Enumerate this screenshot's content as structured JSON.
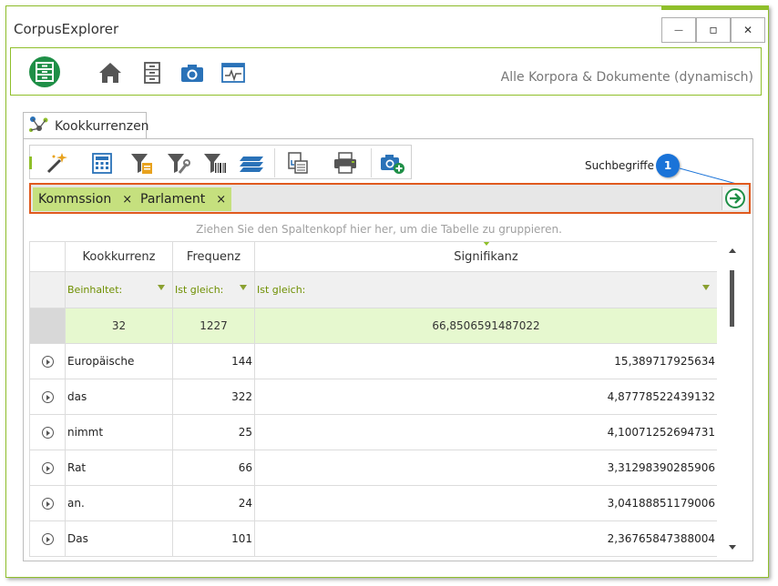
{
  "window": {
    "title": "CorpusExplorer",
    "minimize": "—",
    "maximize": "▫",
    "close": "✕"
  },
  "main_toolbar": {
    "icons": [
      "logo-icon",
      "home-icon",
      "cabinet-icon",
      "camera-icon",
      "activity-monitor-icon"
    ],
    "context_label": "Alle Korpora & Dokumente (dynamisch)"
  },
  "tab": {
    "label": "Kookkurrenzen"
  },
  "sub_toolbar": {
    "icons": [
      "magic-wand-icon",
      "calculator-icon",
      "filter-clipboard-icon",
      "filter-wrench-icon",
      "filter-barcode-icon",
      "layers-icon",
      "export-document-icon",
      "print-icon",
      "camera-add-icon"
    ]
  },
  "search": {
    "label": "Suchbegriffe",
    "callout_number": "1",
    "terms": [
      "Kommssion",
      "Parlament"
    ],
    "remove_glyph": "×"
  },
  "grid": {
    "group_hint": "Ziehen Sie den Spaltenkopf hier her, um die Tabelle zu gruppieren.",
    "columns": [
      "Kookkurrenz",
      "Frequenz",
      "Signifikanz"
    ],
    "filters": [
      "Beinhaltet:",
      "Ist gleich:",
      "Ist gleich:"
    ],
    "summary": {
      "kookkurrenz": "32",
      "frequenz": "1227",
      "signifikanz": "66,8506591487022"
    },
    "rows": [
      {
        "term": "Europäische",
        "freq": "144",
        "sig": "15,389717925634"
      },
      {
        "term": "das",
        "freq": "322",
        "sig": "4,87778522439132"
      },
      {
        "term": "nimmt",
        "freq": "25",
        "sig": "4,10071252694731"
      },
      {
        "term": "Rat",
        "freq": "66",
        "sig": "3,31298390285906"
      },
      {
        "term": "an.",
        "freq": "24",
        "sig": "3,04188851179006"
      },
      {
        "term": "Das",
        "freq": "101",
        "sig": "2,36765847388004"
      }
    ]
  },
  "colors": {
    "accent": "#8fbf2a",
    "chip": "#c5e07e",
    "search_border": "#e05a1e",
    "callout": "#1a73d8"
  }
}
